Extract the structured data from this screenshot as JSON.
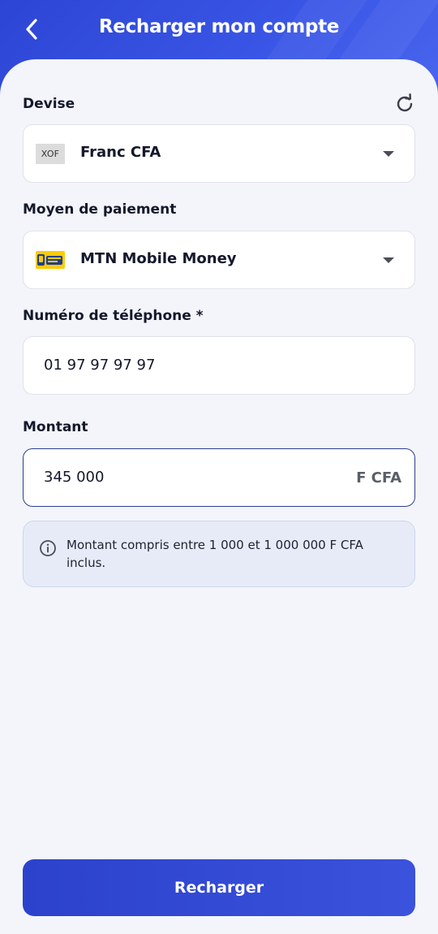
{
  "header": {
    "title": "Recharger mon compte"
  },
  "currency": {
    "label": "Devise",
    "code": "XOF",
    "selected": "Franc CFA"
  },
  "payment": {
    "label": "Moyen de paiement",
    "selected": "MTN Mobile Money"
  },
  "phone": {
    "label": "Numéro de téléphone *",
    "value": "01 97 97 97 97"
  },
  "amount": {
    "label": "Montant",
    "value": "345 000",
    "suffix": "F CFA"
  },
  "info": {
    "text": "Montant compris entre 1 000  et 1 000 000  F CFA inclus."
  },
  "actions": {
    "submit_label": "Recharger"
  },
  "colors": {
    "primary": "#3048d6",
    "background": "#f3f5fa",
    "mtn_yellow": "#ffcb05"
  }
}
